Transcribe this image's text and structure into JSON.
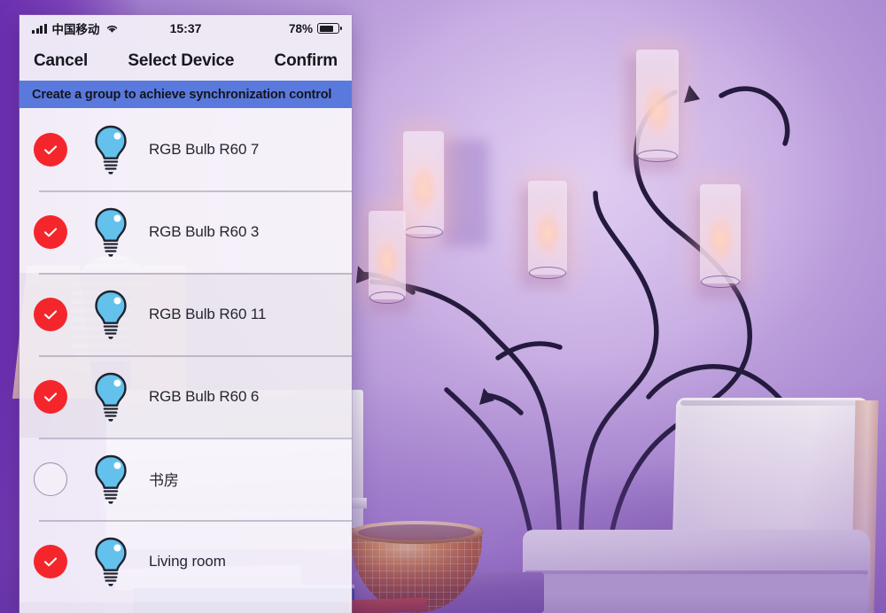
{
  "status_bar": {
    "signal_icon": "cellular-signal-icon",
    "carrier": "中国移动",
    "wifi_icon": "wifi-icon",
    "time": "15:37",
    "battery_percent": "78%",
    "battery_icon": "battery-icon",
    "battery_level": 78
  },
  "nav_bar": {
    "cancel_label": "Cancel",
    "title": "Select Device",
    "confirm_label": "Confirm"
  },
  "banner": {
    "text": "Create a group to achieve synchronization control",
    "background_color": "#5a79dd",
    "text_color": "#14151c"
  },
  "colors": {
    "checked": "#f4262c",
    "unchecked_border": "#9b8fab",
    "bulb_fill": "#63c1ec",
    "bulb_outline": "#1f2330",
    "screen_background": "#f6f3f9",
    "wall": "#b68fd9"
  },
  "device_list": [
    {
      "name": "RGB Bulb R60 7",
      "selected": true,
      "icon": "bulb-icon",
      "check_icon": "check-circle-icon"
    },
    {
      "name": "RGB Bulb R60 3",
      "selected": true,
      "icon": "bulb-icon",
      "check_icon": "check-circle-icon"
    },
    {
      "name": "RGB Bulb R60 11",
      "selected": true,
      "icon": "bulb-icon",
      "check_icon": "check-circle-icon"
    },
    {
      "name": "RGB Bulb R60 6",
      "selected": true,
      "icon": "bulb-icon",
      "check_icon": "check-circle-icon"
    },
    {
      "name": "书房",
      "selected": false,
      "icon": "bulb-icon",
      "check_icon": "empty-circle-icon"
    },
    {
      "name": "Living room",
      "selected": true,
      "icon": "bulb-icon",
      "check_icon": "check-circle-icon"
    }
  ]
}
